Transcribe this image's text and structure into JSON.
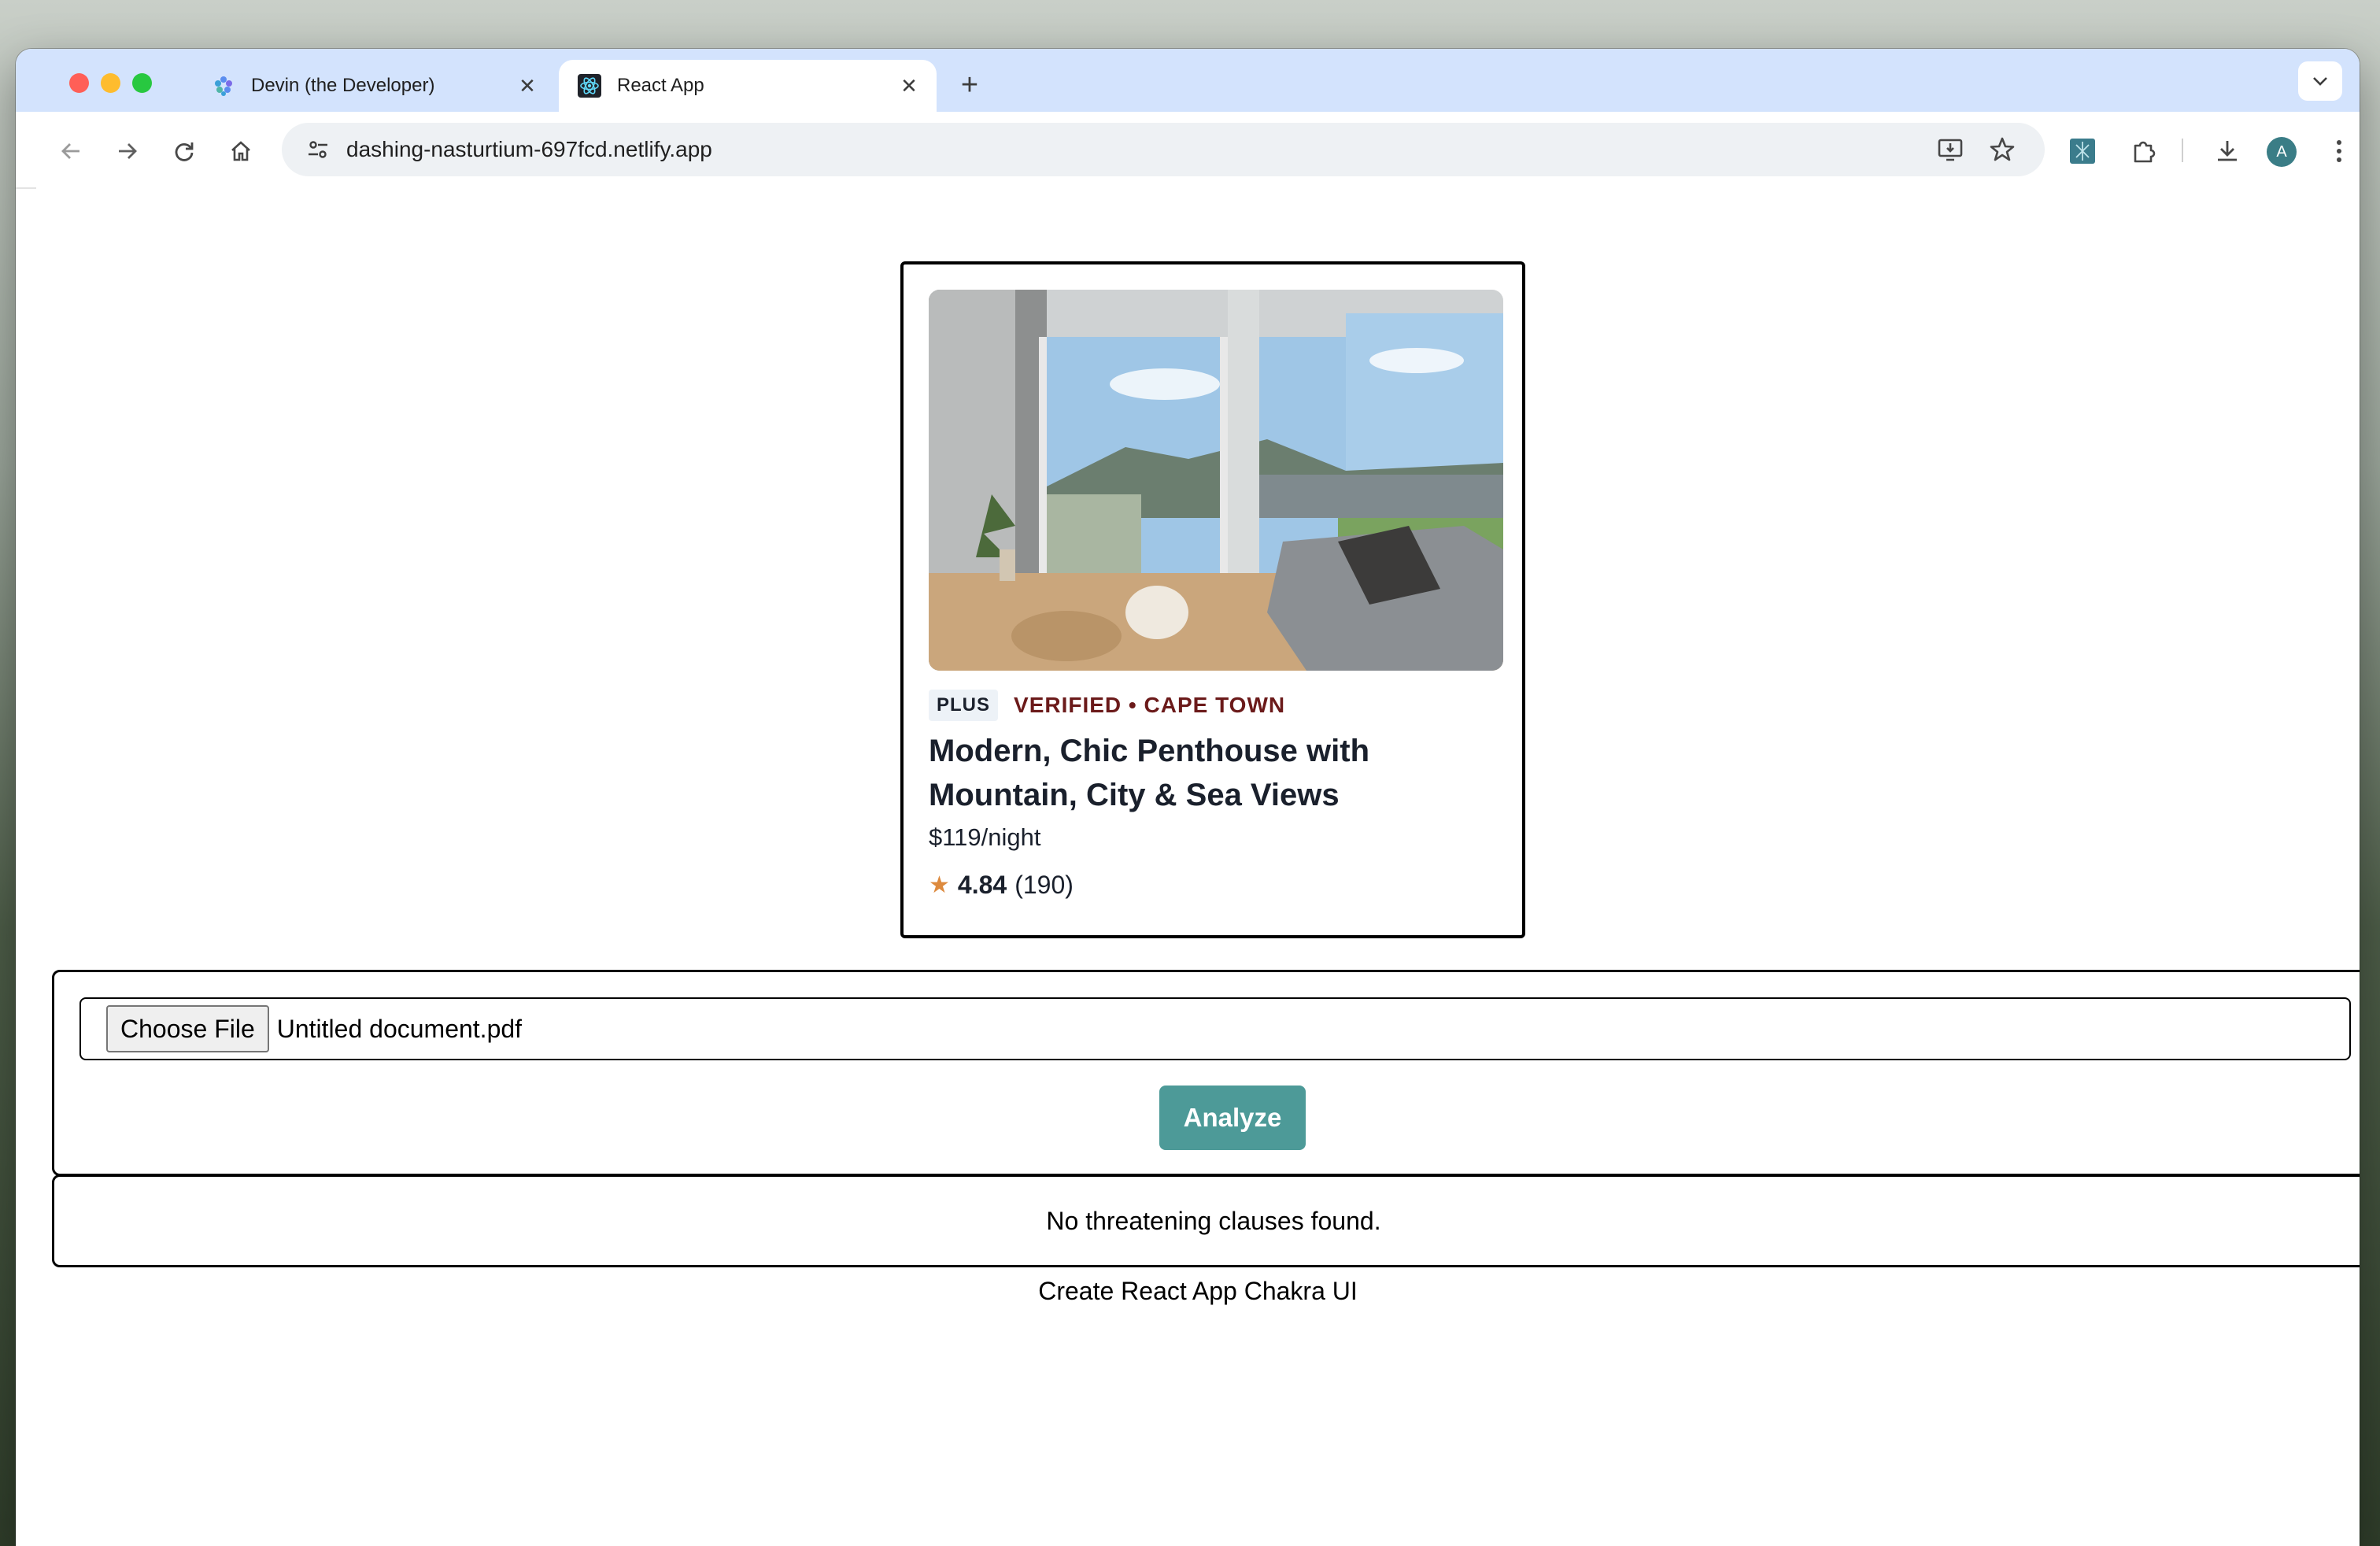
{
  "browser": {
    "tabs": [
      {
        "title": "Devin (the Developer)",
        "active": false,
        "favicon": "devin-icon"
      },
      {
        "title": "React App",
        "active": true,
        "favicon": "react-icon"
      }
    ],
    "url": "dashing-nasturtium-697fcd.netlify.app",
    "profile_initial": "A",
    "accent": "#d3e3fd"
  },
  "listing": {
    "badge": "PLUS",
    "verified_location": "VERIFIED • CAPE TOWN",
    "title": "Modern, Chic Penthouse with Mountain, City & Sea Views",
    "price": "$119/night",
    "rating": {
      "star": "★",
      "value": "4.84",
      "count": "(190)"
    },
    "colors": {
      "location": "#6b1a1a",
      "star": "#dd8a3e"
    }
  },
  "upload": {
    "choose_file_label": "Choose File",
    "file_name": "Untitled document.pdf",
    "analyze_label": "Analyze",
    "analyze_color": "#4d9a98"
  },
  "result": {
    "text": "No threatening clauses found."
  },
  "footer": {
    "text": "Create React App Chakra UI"
  }
}
